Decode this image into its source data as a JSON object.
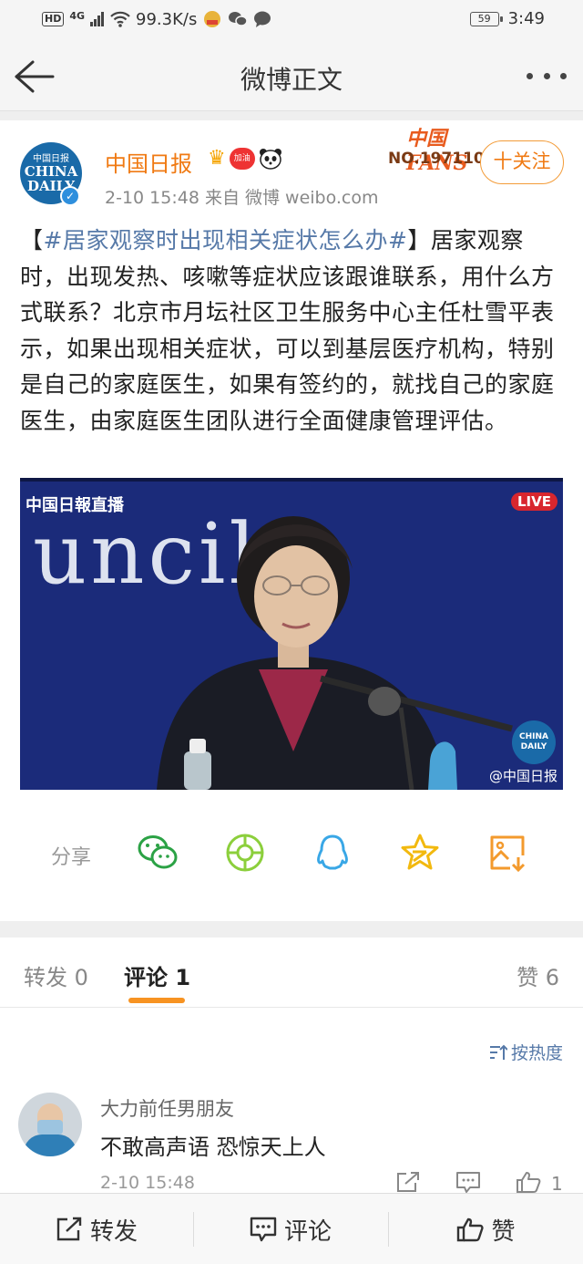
{
  "status_bar": {
    "hd": "HD",
    "network": "4G",
    "speed": "99.3K/s",
    "battery": "59",
    "time": "3:49"
  },
  "nav": {
    "title": "微博正文"
  },
  "post": {
    "author": "中国日报",
    "avatar_small": "中国日报",
    "avatar_text_1": "CHINA",
    "avatar_text_2": "DAILY",
    "badge_jiayou": "加油",
    "meta": "2-10 15:48   来自 微博 weibo.com",
    "fans_title": "中国FANS",
    "fans_no": "NO.1971102",
    "follow_label": "十关注",
    "text_open": "【",
    "hashtag": "#居家观察时出现相关症状怎么办#",
    "text_body": "】居家观察时，出现发热、咳嗽等症状应该跟谁联系，用什么方式联系？北京市月坛社区卫生服务中心主任杜雪平表示，如果出现相关症状，可以到基层医疗机构，特别是自己的家庭医生，如果有签约的，就找自己的家庭医生，由家庭医生团队进行全面健康管理评估。",
    "video": {
      "brand": "中国日報直播",
      "live": "LIVE",
      "backdrop_text": "uncil",
      "logo_1": "CHINA",
      "logo_2": "DAILY",
      "watermark": "@中国日报"
    }
  },
  "share": {
    "label": "分享",
    "icons": [
      "wechat-icon",
      "moments-icon",
      "qq-icon",
      "qzone-star-icon",
      "save-image-icon"
    ]
  },
  "tabs": {
    "repost": "转发 0",
    "comment": "评论 1",
    "like": "赞 6"
  },
  "sort_label": "按热度",
  "comment": {
    "user": "大力前任男朋友",
    "text": "不敢高声语 恐惊天上人",
    "time": "2-10 15:48",
    "likes": "1"
  },
  "bottom_bar": {
    "repost": "转发",
    "comment": "评论",
    "like": "赞"
  },
  "colors": {
    "accent_orange": "#f07a13",
    "link_blue": "#5679a8",
    "tab_underline": "#f79322"
  }
}
